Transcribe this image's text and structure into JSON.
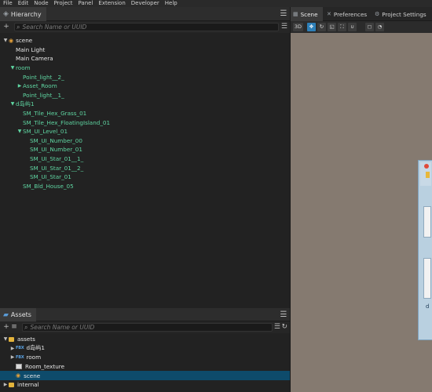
{
  "menu": [
    "File",
    "Edit",
    "Node",
    "Project",
    "Panel",
    "Extension",
    "Developer",
    "Help"
  ],
  "hierarchy": {
    "tab_label": "Hierarchy",
    "search_placeholder": "Search Name or UUID",
    "nodes": [
      {
        "label": "scene",
        "depth": 0,
        "expanded": true,
        "kind": "scene"
      },
      {
        "label": "Main Light",
        "depth": 1,
        "kind": "node"
      },
      {
        "label": "Main Camera",
        "depth": 1,
        "kind": "node"
      },
      {
        "label": "room",
        "depth": 1,
        "expanded": true,
        "kind": "prefab"
      },
      {
        "label": "Point_light__2_",
        "depth": 2,
        "kind": "prefab"
      },
      {
        "label": "Asset_Room",
        "depth": 2,
        "expanded": false,
        "kind": "prefab"
      },
      {
        "label": "Point_light__1_",
        "depth": 2,
        "kind": "prefab"
      },
      {
        "label": "d岛屿1",
        "depth": 1,
        "expanded": true,
        "kind": "prefab"
      },
      {
        "label": "SM_Tile_Hex_Grass_01",
        "depth": 2,
        "kind": "prefab"
      },
      {
        "label": "SM_Tile_Hex_FloatingIsland_01",
        "depth": 2,
        "kind": "prefab"
      },
      {
        "label": "SM_UI_Level_01",
        "depth": 2,
        "expanded": true,
        "kind": "prefab"
      },
      {
        "label": "SM_UI_Number_00",
        "depth": 3,
        "kind": "prefab"
      },
      {
        "label": "SM_UI_Number_01",
        "depth": 3,
        "kind": "prefab"
      },
      {
        "label": "SM_UI_Star_01__1_",
        "depth": 3,
        "kind": "prefab"
      },
      {
        "label": "SM_UI_Star_01__2_",
        "depth": 3,
        "kind": "prefab"
      },
      {
        "label": "SM_UI_Star_01",
        "depth": 3,
        "kind": "prefab"
      },
      {
        "label": "SM_Bld_House_05",
        "depth": 2,
        "kind": "prefab"
      }
    ]
  },
  "assets": {
    "tab_label": "Assets",
    "search_placeholder": "Search Name or UUID",
    "items": [
      {
        "label": "assets",
        "depth": 0,
        "expanded": true,
        "icon": "db"
      },
      {
        "label": "d岛屿1",
        "depth": 1,
        "expanded": false,
        "icon": "fbx"
      },
      {
        "label": "room",
        "depth": 1,
        "expanded": false,
        "icon": "fbx"
      },
      {
        "label": "Room_texture",
        "depth": 1,
        "icon": "texture"
      },
      {
        "label": "scene",
        "depth": 1,
        "icon": "scene",
        "selected": true
      },
      {
        "label": "internal",
        "depth": 0,
        "expanded": false,
        "icon": "db"
      }
    ],
    "fbx_badge": "FBX"
  },
  "scene_panel": {
    "tabs": [
      {
        "label": "Scene",
        "active": true
      },
      {
        "label": "Preferences",
        "active": false
      },
      {
        "label": "Project Settings",
        "active": false
      }
    ],
    "toolbar_3d": "3D",
    "viewport_fragment_text": "d"
  }
}
